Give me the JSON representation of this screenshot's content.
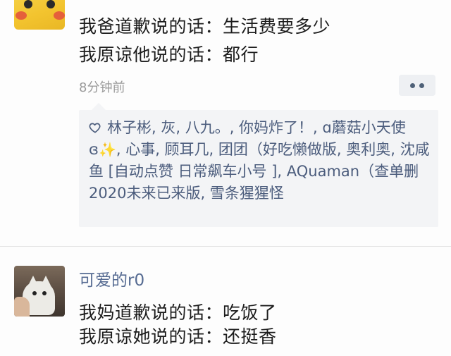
{
  "post1": {
    "lines": [
      "我爸道歉说的话：生活费要多少",
      "我原谅他说的话：都行"
    ],
    "time": "8分钟前"
  },
  "likes": {
    "icon": "heart-outline-icon",
    "text_before_sparkle": "林子彬, 灰, 八九。, 你妈炸了！, ɑ蘑菇小天使ɞ",
    "sparkle": "✨",
    "text_after_sparkle": ", 心事, 顾耳几, 团团（好吃懒做版, 奥利奥, 沈咸鱼 [自动点赞 日常飙车小号 ], AQuaman（查单删2020未来已来版, 雪条猩猩怪",
    "color": "#4c5d7d"
  },
  "post2": {
    "username": "可爱的r0",
    "lines": [
      "我妈道歉说的话：吃饭了",
      "我原谅她说的话：还挺香"
    ]
  },
  "colors": {
    "username": "#566b92",
    "more_button_bg": "#eef0f3",
    "likes_bg": "#f3f4f6"
  }
}
